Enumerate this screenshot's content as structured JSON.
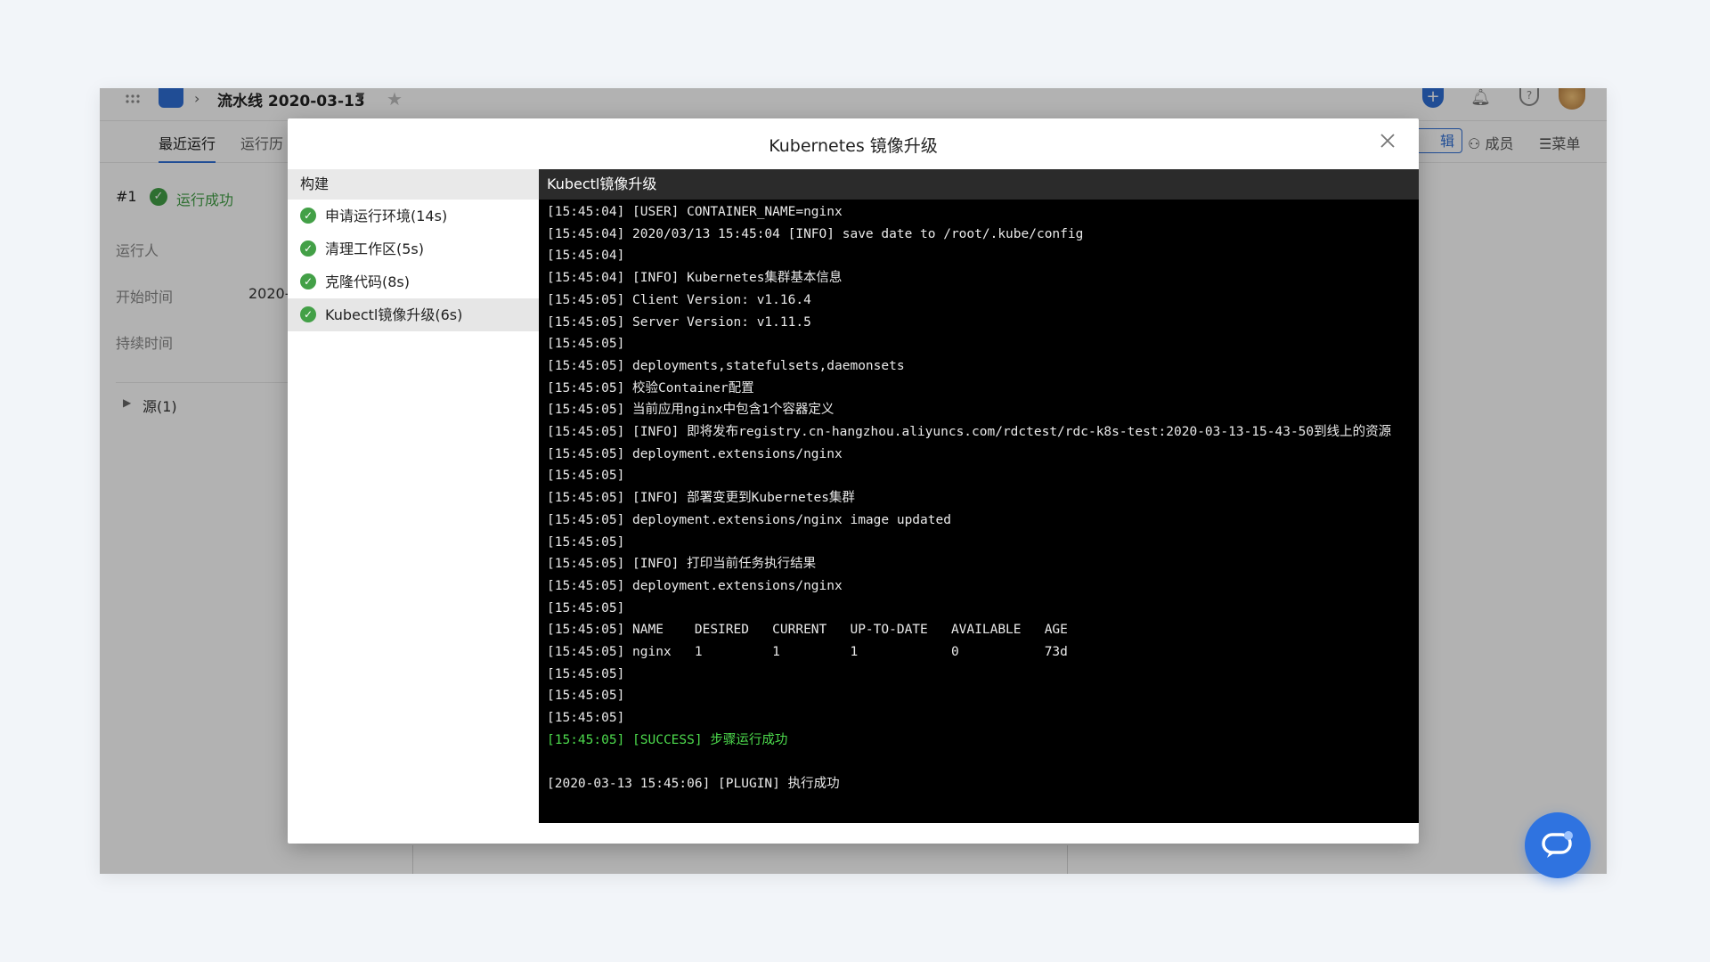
{
  "app": {
    "pipeline_name": "流水线 2020-03-13",
    "icons": {
      "grid": "apps-grid-icon",
      "logo": "project-logo-icon",
      "star": "star-icon",
      "plus": "plus-circle-icon",
      "bell": "bell-icon",
      "help": "help-icon",
      "avatar": "user-avatar"
    },
    "tabs": {
      "recent": "最近运行",
      "history": "运行历"
    },
    "edit_label": "辑",
    "members_label": "成员",
    "menu_label": "菜单",
    "run": {
      "number": "#1",
      "status": "运行成功",
      "runner_label": "运行人",
      "start_label": "开始时间",
      "start_value": "2020-",
      "duration_label": "持续时间",
      "source_label": "源(1)"
    }
  },
  "modal": {
    "title": "Kubernetes 镜像升级",
    "steps_header": "构建",
    "steps": [
      {
        "label": "申请运行环境(14s)",
        "status": "success"
      },
      {
        "label": "清理工作区(5s)",
        "status": "success"
      },
      {
        "label": "克隆代码(8s)",
        "status": "success"
      },
      {
        "label": "Kubectl镜像升级(6s)",
        "status": "success",
        "active": true
      }
    ],
    "console_title": "Kubectl镜像升级",
    "log_lines": [
      "[15:45:04] [USER] CONTAINER_NAME=nginx",
      "[15:45:04] 2020/03/13 15:45:04 [INFO] save date to /root/.kube/config",
      "[15:45:04]",
      "[15:45:04] [INFO] Kubernetes集群基本信息",
      "[15:45:05] Client Version: v1.16.4",
      "[15:45:05] Server Version: v1.11.5",
      "[15:45:05]",
      "[15:45:05] deployments,statefulsets,daemonsets",
      "[15:45:05] 校验Container配置",
      "[15:45:05] 当前应用nginx中包含1个容器定义",
      "[15:45:05] [INFO] 即将发布registry.cn-hangzhou.aliyuncs.com/rdctest/rdc-k8s-test:2020-03-13-15-43-50到线上的资源",
      "[15:45:05] deployment.extensions/nginx",
      "[15:45:05]",
      "[15:45:05] [INFO] 部署变更到Kubernetes集群",
      "[15:45:05] deployment.extensions/nginx image updated",
      "[15:45:05]",
      "[15:45:05] [INFO] 打印当前任务执行结果",
      "[15:45:05] deployment.extensions/nginx",
      "[15:45:05]",
      "[15:45:05] NAME    DESIRED   CURRENT   UP-TO-DATE   AVAILABLE   AGE",
      "[15:45:05] nginx   1         1         1            0           73d",
      "[15:45:05]",
      "[15:45:05]",
      "[15:45:05]",
      "[15:45:05] [SUCCESS] 步骤运行成功",
      "",
      "[2020-03-13 15:45:06] [PLUGIN] 执行成功"
    ],
    "success_line_index": 24
  },
  "colors": {
    "accent": "#2f6fd6",
    "success": "#43a047",
    "console_success": "#4ddb4d",
    "console_bg": "#000000"
  }
}
